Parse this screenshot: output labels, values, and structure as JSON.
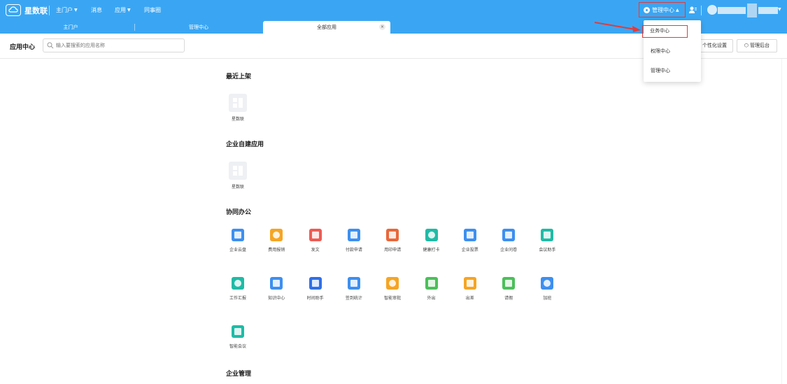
{
  "brand": "星数联",
  "topnav": [
    {
      "label": "主门户",
      "caret": true
    },
    {
      "label": "消息",
      "caret": false
    },
    {
      "label": "应用",
      "caret": true
    },
    {
      "label": "同事圈",
      "caret": false
    }
  ],
  "manage_button": "管理中心",
  "tabs": [
    {
      "label": "主门户",
      "active": false
    },
    {
      "label": "管理中心",
      "active": false
    },
    {
      "label": "全部应用",
      "active": true
    }
  ],
  "tab_close": "×",
  "page_title": "应用中心",
  "search_placeholder": "输入要搜索的应用名称",
  "right_buttons": [
    "个性化设置",
    "管理后台"
  ],
  "dropdown_items": [
    "业务中心",
    "权限中心",
    "管理中心"
  ],
  "sections": [
    {
      "title": "最近上架",
      "apps": [
        {
          "label": "星数联"
        }
      ]
    },
    {
      "title": "企业自建应用",
      "apps": [
        {
          "label": "星数联"
        }
      ]
    },
    {
      "title": "协同办公",
      "apps": [
        {
          "label": "企业云盘",
          "color": "#3d8ff0"
        },
        {
          "label": "费用报销",
          "color": "#f5a524"
        },
        {
          "label": "发文",
          "color": "#ec5b53"
        },
        {
          "label": "付款申请",
          "color": "#3d8ff0"
        },
        {
          "label": "用印申请",
          "color": "#e8673a"
        },
        {
          "label": "健康打卡",
          "color": "#1fbba6"
        },
        {
          "label": "企业投票",
          "color": "#3d8ff0"
        },
        {
          "label": "企业问卷",
          "color": "#3d8ff0"
        },
        {
          "label": "会议助手",
          "color": "#1fbba6"
        },
        {
          "label": "工作汇报",
          "color": "#1fbba6"
        },
        {
          "label": "知识中心",
          "color": "#3d8ff0"
        },
        {
          "label": "时间助手",
          "color": "#2f6fe8"
        },
        {
          "label": "签到统计",
          "color": "#3d8ff0"
        },
        {
          "label": "智能审批",
          "color": "#f5a524"
        },
        {
          "label": "外出",
          "color": "#4cbf5a"
        },
        {
          "label": "出差",
          "color": "#f5a524"
        },
        {
          "label": "请假",
          "color": "#4cbf5a"
        },
        {
          "label": "加班",
          "color": "#3d8ff0"
        },
        {
          "label": "智能会议",
          "color": "#1fbba6"
        }
      ]
    },
    {
      "title": "企业管理",
      "apps": []
    }
  ],
  "colors": {
    "topbar": "#3aa6f3",
    "highlight": "#e23b3b"
  }
}
